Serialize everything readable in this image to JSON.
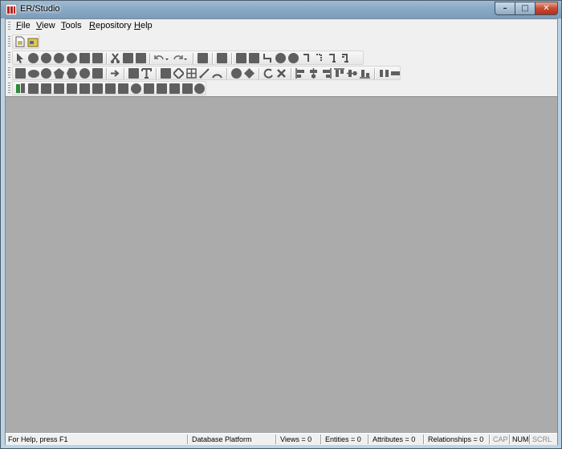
{
  "window": {
    "title": "ER/Studio",
    "controls": {
      "minimize": "–",
      "maximize": "□",
      "close": "✕"
    }
  },
  "menu": {
    "items": [
      {
        "label": "File",
        "mnemonic": "F",
        "rest": "ile"
      },
      {
        "label": "View",
        "mnemonic": "V",
        "rest": "iew"
      },
      {
        "label": "Tools",
        "mnemonic": "T",
        "rest": "ools"
      },
      {
        "label": "Repository",
        "mnemonic": "R",
        "rest": "epository"
      },
      {
        "label": "Help",
        "mnemonic": "H",
        "rest": "elp"
      }
    ]
  },
  "toolbars": {
    "file": [
      "new-model-icon",
      "open-model-icon"
    ],
    "standard": [
      "select-pointer-icon",
      "hand-pan-icon",
      "zoom-in-icon",
      "zoom-out-icon",
      "zoom-fit-icon",
      "pan-zoom-icon",
      "move-icon",
      "cut-icon",
      "copy-icon",
      "paste-icon",
      "undo-icon",
      "redo-icon",
      "format-painter-icon",
      "properties-icon",
      "table-icon",
      "entity-icon",
      "relationship-icon",
      "view-icon",
      "shape-icon",
      "identifying-relation-icon",
      "non-identifying-relation-icon",
      "one-to-one-icon",
      "non-specific-icon"
    ],
    "drawing": [
      "rectangle-icon",
      "rounded-rect-icon",
      "circle-icon",
      "pentagon-icon",
      "hexagon-icon",
      "octagon-icon",
      "image-icon",
      "arrow-icon",
      "text-block-icon",
      "text-icon",
      "view-relationship-icon",
      "subtype-icon",
      "diamond-icon",
      "grid-icon",
      "line-icon",
      "arc-icon",
      "circle-shape-icon",
      "link-icon",
      "align-left-icon",
      "align-center-icon",
      "align-right-icon",
      "align-top-icon",
      "align-middle-icon",
      "align-bottom-icon",
      "distribute-icon"
    ],
    "database": [
      "db-object-icon"
    ]
  },
  "status": {
    "help": "For Help, press F1",
    "platform": "Database Platform",
    "views": "Views = 0",
    "entities": "Entities = 0",
    "attributes": "Attributes = 0",
    "relationships": "Relationships = 0",
    "cap": "CAP",
    "num": "NUM",
    "scrl": "SCRL"
  },
  "colors": {
    "workspace": "#ababab",
    "chrome": "#f0f0f0",
    "icon": "#5f5f5f"
  }
}
